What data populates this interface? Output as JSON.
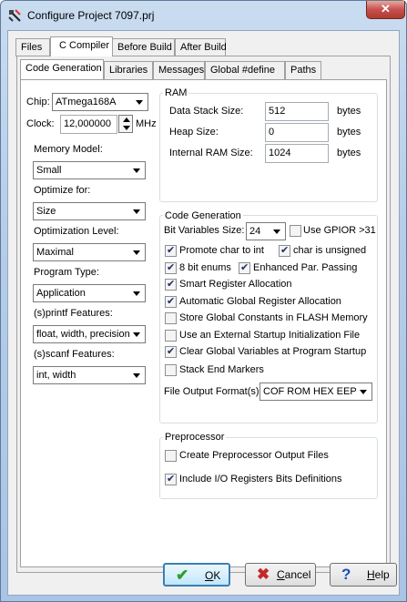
{
  "window": {
    "title": "Configure Project 7097.prj",
    "close_symbol": "✕"
  },
  "main_tabs": [
    {
      "label": "Files"
    },
    {
      "label": "C Compiler"
    },
    {
      "label": "Before Build"
    },
    {
      "label": "After Build"
    }
  ],
  "sub_tabs": [
    {
      "label": "Code Generation"
    },
    {
      "label": "Libraries"
    },
    {
      "label": "Messages"
    },
    {
      "label": "Global #define"
    },
    {
      "label": "Paths"
    }
  ],
  "left": {
    "chip_label": "Chip:",
    "chip_value": "ATmega168A",
    "clock_label": "Clock:",
    "clock_value": "12,000000",
    "clock_unit": "MHz",
    "memory_model_label": "Memory Model:",
    "memory_model_value": "Small",
    "optimize_for_label": "Optimize for:",
    "optimize_for_value": "Size",
    "optimization_level_label": "Optimization Level:",
    "optimization_level_value": "Maximal",
    "program_type_label": "Program Type:",
    "program_type_value": "Application",
    "printf_label": "(s)printf Features:",
    "printf_value": "float, width, precision",
    "scanf_label": "(s)scanf Features:",
    "scanf_value": "int, width"
  },
  "ram": {
    "title": "RAM",
    "data_stack_label": "Data Stack Size:",
    "data_stack_value": "512",
    "heap_label": "Heap Size:",
    "heap_value": "0",
    "internal_ram_label": "Internal RAM Size:",
    "internal_ram_value": "1024",
    "unit": "bytes"
  },
  "codegen": {
    "title": "Code Generation",
    "bit_vars_label": "Bit Variables Size:",
    "bit_vars_value": "24",
    "gpior_label": "Use GPIOR >31",
    "promote_char_label": "Promote char to int",
    "char_unsigned_label": "char is unsigned",
    "bit_enums_label": "8 bit enums",
    "enhanced_par_label": "Enhanced Par. Passing",
    "smart_reg_label": "Smart Register Allocation",
    "auto_global_reg_label": "Automatic Global Register Allocation",
    "store_flash_label": "Store Global Constants in FLASH Memory",
    "external_init_label": "Use an External Startup Initialization File",
    "clear_globals_label": "Clear Global Variables at Program Startup",
    "stack_end_label": "Stack End Markers",
    "output_format_label": "File Output Format(s):",
    "output_format_value": "COF ROM HEX EEP"
  },
  "checks": {
    "gpior": false,
    "promote_char": true,
    "char_unsigned": true,
    "bit_enums": true,
    "enhanced_par": true,
    "smart_reg": true,
    "auto_global_reg": true,
    "store_flash": false,
    "external_init": false,
    "clear_globals": true,
    "stack_end": false,
    "preproc_output": false,
    "include_io": true
  },
  "preprocessor": {
    "title": "Preprocessor",
    "output_files_label": "Create Preprocessor Output Files",
    "include_io_label": "Include I/O Registers Bits Definitions"
  },
  "buttons": {
    "ok_label": "OK",
    "cancel_label": "Cancel",
    "help_label": "Help",
    "ok_icon": "check-icon",
    "cancel_icon": "x-icon",
    "help_icon": "question-icon"
  },
  "colors": {
    "ok_green": "#2e9e2e",
    "cancel_red": "#c62828",
    "help_blue": "#1c4fb8"
  }
}
